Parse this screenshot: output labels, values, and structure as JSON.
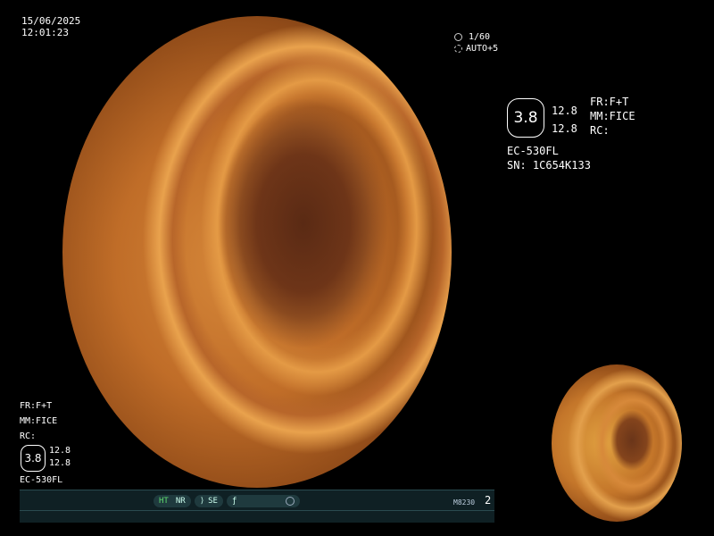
{
  "timestamp": {
    "date": "15/06/2025",
    "time": "12:01:23"
  },
  "exposure": {
    "shutter": "1/60",
    "auto": "AUTO+5",
    "shutter_icon": "shutter-icon",
    "auto_icon": "iris-icon"
  },
  "settings_right": {
    "zoom": "3.8",
    "value_top": "12.8",
    "value_bottom": "12.8",
    "fr": "FR:F+T",
    "mm": "MM:FICE",
    "rc": "RC:",
    "scope": "EC-530FL",
    "serial": "SN: 1C654K133"
  },
  "settings_left": {
    "fr": "FR:F+T",
    "mm": "MM:FICE",
    "rc": "RC:",
    "zoom": "3.8",
    "value_top": "12.8",
    "value_bottom": "12.8",
    "scope": "EC-530FL"
  },
  "status_bar": {
    "ht": "HT",
    "nr": "NR",
    "se": "SE",
    "code": "M8230",
    "page": "2",
    "colors": {
      "background": "#0f2024",
      "ht": "#5fdc6f"
    }
  }
}
